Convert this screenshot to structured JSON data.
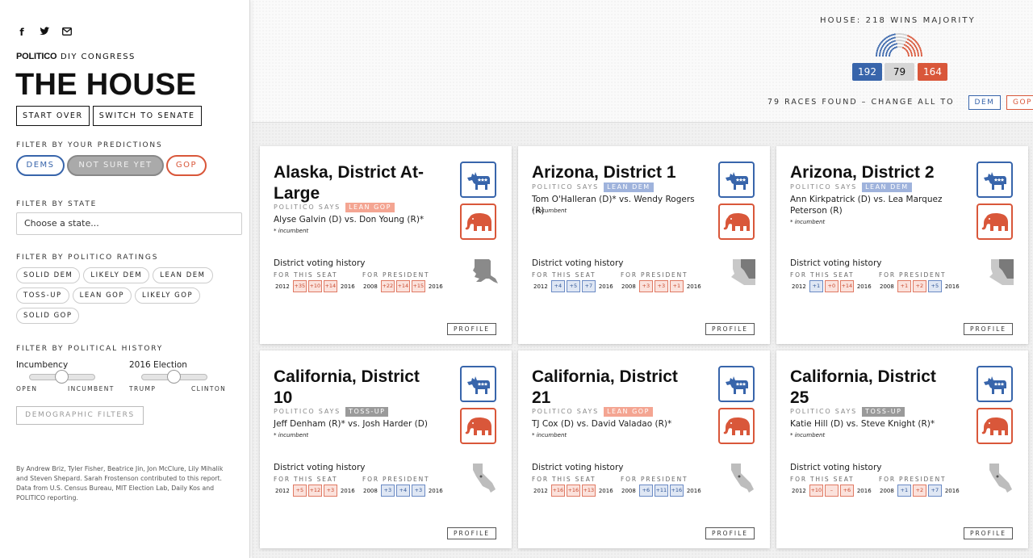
{
  "sidebar": {
    "brand_logo": "POLITICO",
    "brand_sub": "DIY CONGRESS",
    "title": "THE HOUSE",
    "start_over": "START OVER",
    "switch_senate": "SWITCH TO SENATE",
    "filter_predictions_label": "FILTER BY YOUR PREDICTIONS",
    "pred_dems": "DEMS",
    "pred_notsure": "NOT SURE YET",
    "pred_gop": "GOP",
    "filter_state_label": "FILTER BY STATE",
    "state_placeholder": "Choose a state...",
    "filter_ratings_label": "FILTER BY POLITICO RATINGS",
    "ratings": [
      "SOLID DEM",
      "LIKELY DEM",
      "LEAN DEM",
      "TOSS-UP",
      "LEAN GOP",
      "LIKELY GOP",
      "SOLID GOP"
    ],
    "filter_history_label": "FILTER BY POLITICAL HISTORY",
    "incumbency_label": "Incumbency",
    "incumbency_left": "OPEN",
    "incumbency_right": "INCUMBENT",
    "election_label": "2016 Election",
    "election_left": "TRUMP",
    "election_right": "CLINTON",
    "demographic_filters": "DEMOGRAPHIC FILTERS",
    "credits": "By Andrew Briz, Tyler Fisher, Beatrice Jin, Jon McClure, Lily Mihalik and Steven Shepard. Sarah Frostenson contributed to this report. Data from U.S. Census Bureau, MIT Election Lab, Daily Kos and POLITICO reporting."
  },
  "header": {
    "majority_label": "HOUSE: 218 WINS MAJORITY",
    "dem_count": "192",
    "tossup_count": "79",
    "gop_count": "164",
    "races_found": "79 RACES FOUND – CHANGE ALL TO",
    "change_dem": "DEM",
    "change_gop": "GOP"
  },
  "card_labels": {
    "politico_says": "POLITICO SAYS",
    "incumbent_note": "* incumbent",
    "voting_history": "District voting history",
    "for_this_seat": "FOR THIS SEAT",
    "for_president": "FOR PRESIDENT",
    "year_start_seat": "2012",
    "year_end": "2016",
    "year_start_pres": "2008",
    "profile": "PROFILE"
  },
  "colors": {
    "dem": "#3865ab",
    "gop": "#d9573a",
    "lean_gop_tag": "#f4a592",
    "lean_dem_tag": "#9fb3dc",
    "tossup_tag": "#9a9a9a"
  },
  "cards": [
    {
      "title": "Alaska, District At-Large",
      "rating": "LEAN GOP",
      "candidates": "Alyse Galvin (D) vs. Don Young (R)*",
      "seat": [
        "+35",
        "+10",
        "+14"
      ],
      "seat_party": [
        "r",
        "r",
        "r"
      ],
      "president": [
        "+22",
        "+14",
        "+15"
      ],
      "president_party": [
        "r",
        "r",
        "r"
      ],
      "map_icon": "alaska-map-icon"
    },
    {
      "title": "Arizona, District 1",
      "rating": "LEAN DEM",
      "candidates": "Tom O'Halleran (D)* vs. Wendy Rogers (R)",
      "seat": [
        "+4",
        "+5",
        "+7"
      ],
      "seat_party": [
        "d",
        "d",
        "d"
      ],
      "president": [
        "+3",
        "+3",
        "+1"
      ],
      "president_party": [
        "r",
        "r",
        "r"
      ],
      "map_icon": "arizona-map-icon"
    },
    {
      "title": "Arizona, District 2",
      "rating": "LEAN DEM",
      "candidates": "Ann Kirkpatrick (D) vs. Lea Marquez Peterson (R)",
      "seat": [
        "+1",
        "+0",
        "+14"
      ],
      "seat_party": [
        "d",
        "r",
        "r"
      ],
      "president": [
        "+1",
        "+2",
        "+5"
      ],
      "president_party": [
        "r",
        "r",
        "d"
      ],
      "map_icon": "arizona-map-icon"
    },
    {
      "title": "California, District 10",
      "rating": "TOSS-UP",
      "candidates": "Jeff Denham (R)* vs. Josh Harder (D)",
      "seat": [
        "+5",
        "+12",
        "+3"
      ],
      "seat_party": [
        "r",
        "r",
        "r"
      ],
      "president": [
        "+3",
        "+4",
        "+3"
      ],
      "president_party": [
        "d",
        "d",
        "d"
      ],
      "map_icon": "california-map-icon"
    },
    {
      "title": "California, District 21",
      "rating": "LEAN GOP",
      "candidates": "TJ Cox (D) vs. David Valadao (R)*",
      "seat": [
        "+16",
        "+16",
        "+13"
      ],
      "seat_party": [
        "r",
        "r",
        "r"
      ],
      "president": [
        "+6",
        "+11",
        "+16"
      ],
      "president_party": [
        "d",
        "d",
        "d"
      ],
      "map_icon": "california-map-icon"
    },
    {
      "title": "California, District 25",
      "rating": "TOSS-UP",
      "candidates": "Katie Hill (D) vs. Steve Knight (R)*",
      "seat": [
        "+10",
        "–",
        "+6"
      ],
      "seat_party": [
        "r",
        "r",
        "r"
      ],
      "president": [
        "+1",
        "+2",
        "+7"
      ],
      "president_party": [
        "d",
        "r",
        "d"
      ],
      "map_icon": "california-map-icon"
    }
  ]
}
